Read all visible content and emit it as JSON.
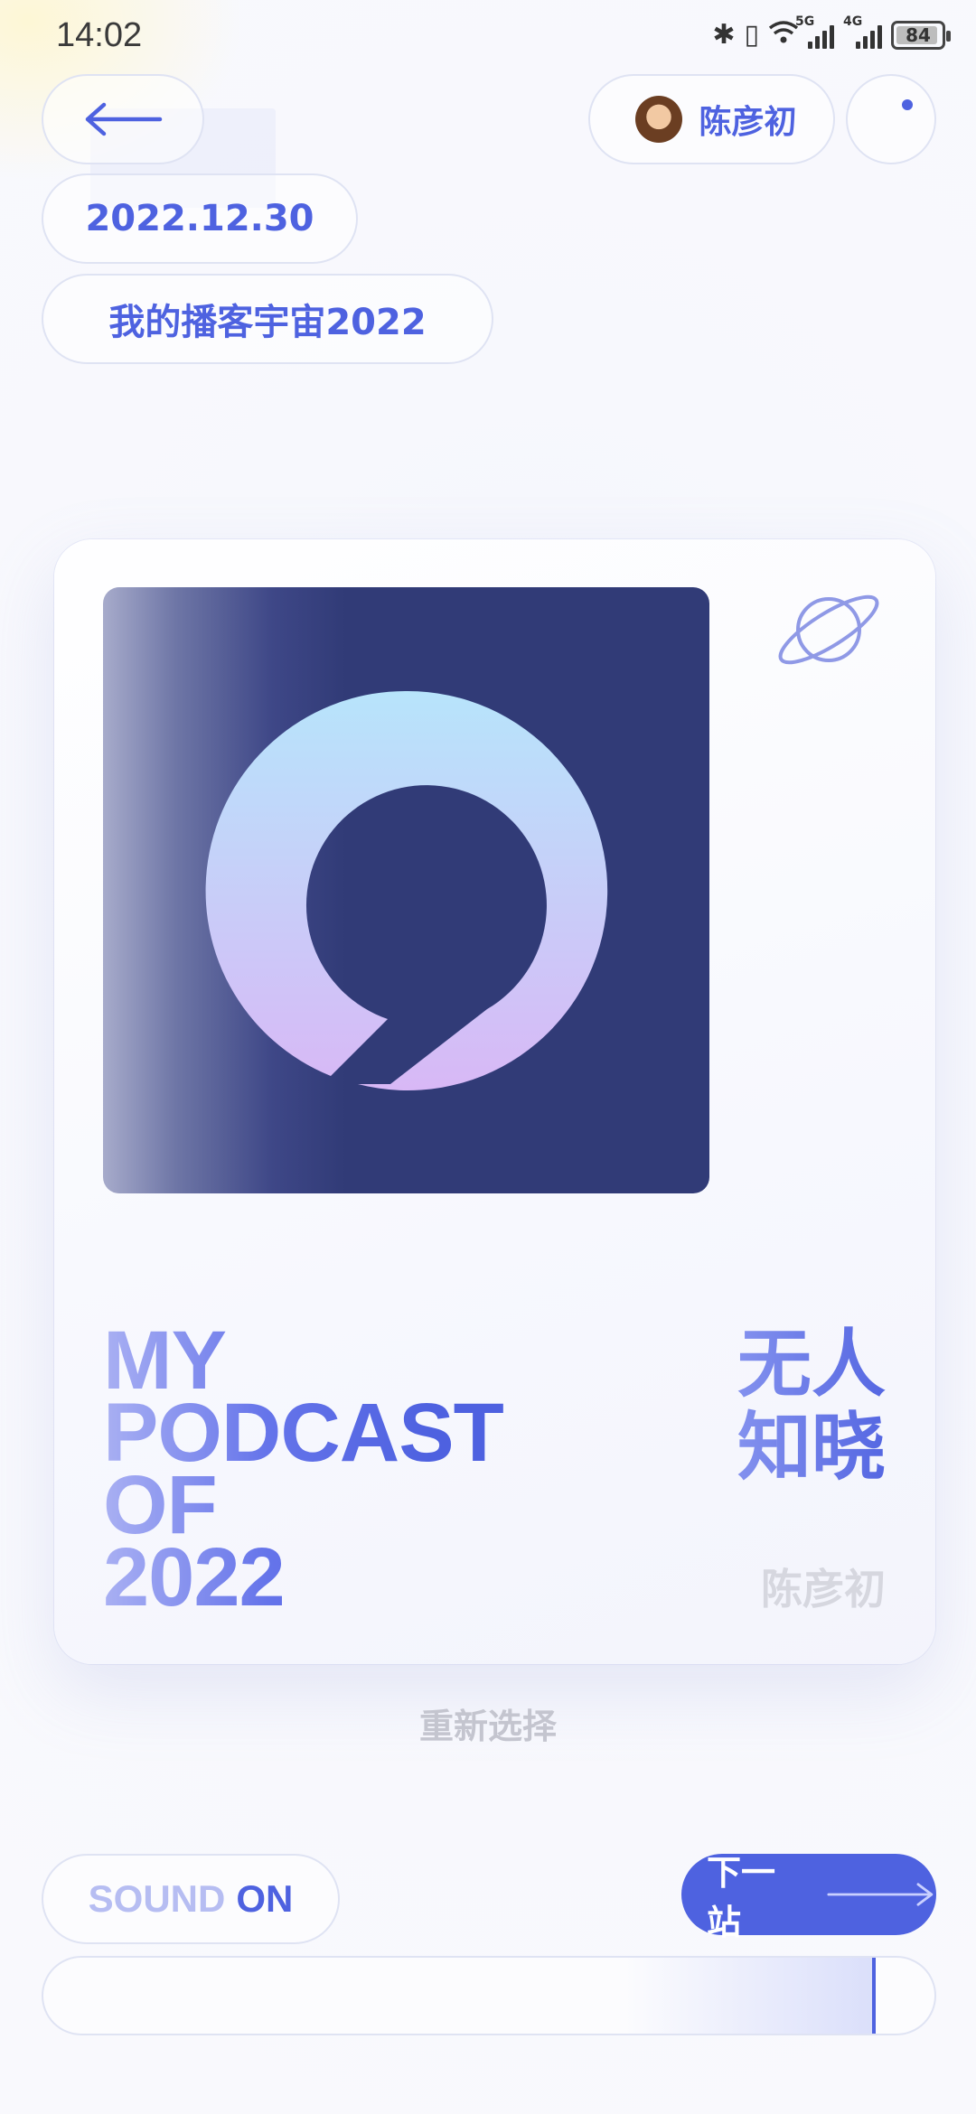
{
  "status_bar": {
    "time": "14:02",
    "signal_1_tag": "5G",
    "signal_2_tag": "4G",
    "battery": "84"
  },
  "header": {
    "user_name": "陈彦初",
    "date": "2022.12.30",
    "page_title": "我的播客宇宙2022"
  },
  "card": {
    "title_en_lines": [
      "MY",
      "PODCAST",
      "OF",
      "2022"
    ],
    "podcast_name_lines": [
      "无人",
      "知晓"
    ],
    "author": "陈彦初"
  },
  "reselect_label": "重新选择",
  "footer": {
    "sound_label_1": "SOUND",
    "sound_label_2": "ON",
    "next_label": "下一站",
    "progress_fraction": 0.93
  },
  "colors": {
    "accent": "#4e62e0",
    "cover_bg": "#313b77"
  },
  "icons": [
    "back-arrow-icon",
    "avatar",
    "more-dot-icon",
    "planet-icon",
    "podcast-logo-icon",
    "arrow-right-icon"
  ]
}
